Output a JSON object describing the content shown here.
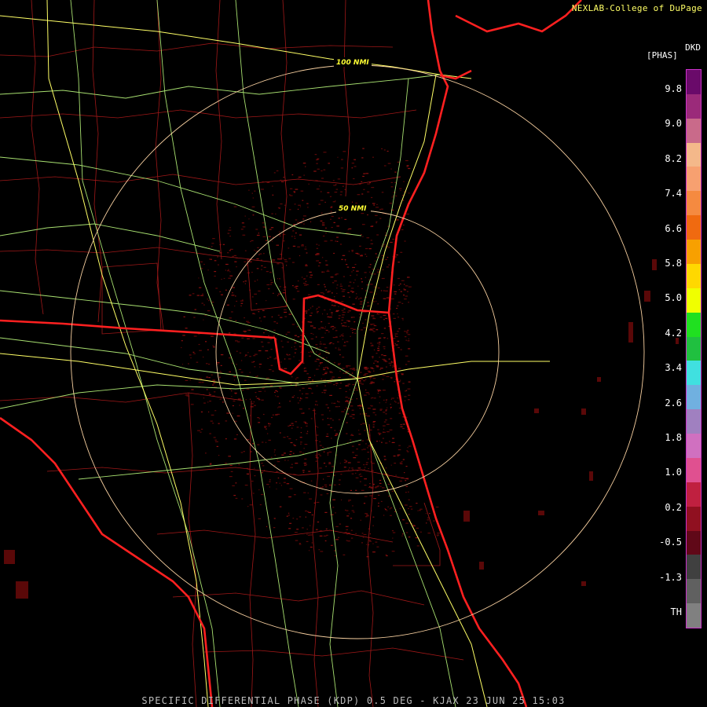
{
  "credit": "NEXLAB-College of DuPage",
  "legend": {
    "title_a": "DKD",
    "title_b": "[PHAS]",
    "ticks": [
      "9.8",
      "9.0",
      "8.2",
      "7.4",
      "6.6",
      "5.8",
      "5.0",
      "4.2",
      "3.4",
      "2.6",
      "1.8",
      "1.0",
      "0.2",
      "-0.5",
      "-1.3",
      "TH"
    ],
    "colors": [
      "#6a0a6a",
      "#9b2a7a",
      "#c96a8a",
      "#f4b88a",
      "#f7a070",
      "#f58a40",
      "#f06a10",
      "#f8a000",
      "#ffd800",
      "#f0ff00",
      "#20e020",
      "#20c040",
      "#40e0e0",
      "#70b0e0",
      "#a080c0",
      "#d070c0",
      "#e05090",
      "#c02040",
      "#901020",
      "#600818",
      "#404040",
      "#606060",
      "#808080"
    ],
    "colors_note": ""
  },
  "rings": [
    {
      "label": "100 NMI"
    },
    {
      "label": "50 NMI"
    }
  ],
  "footer": "SPECIFIC DIFFERENTIAL PHASE (KDP) 0.5 DEG - KJAX 23 JUN 25 15:03",
  "theme": {
    "background": "#000000",
    "county_lines": "#b01818",
    "state_coast": "#ff2020",
    "highways": "#a8e070",
    "interstates": "#ffff66",
    "ring": "#f8d0a0",
    "clutter": "#6a0a0a"
  }
}
